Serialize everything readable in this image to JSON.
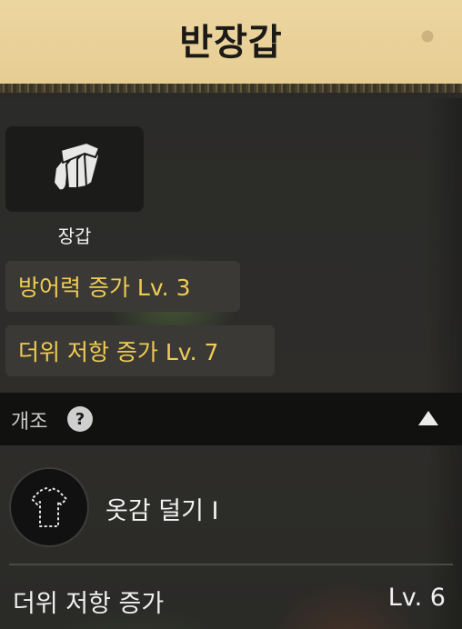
{
  "header": {
    "title": "반장갑"
  },
  "item": {
    "label": "장갑",
    "icon": "glove-icon"
  },
  "stats": [
    {
      "text": "방어력 증가 Lv. 3"
    },
    {
      "text": "더위 저항 증가 Lv. 7"
    }
  ],
  "modification": {
    "section_title": "개조",
    "help_icon": "?",
    "collapse_icon": "▲",
    "option": {
      "label": "옷감 덜기 I",
      "icon": "shirt-outline-icon"
    },
    "effect": {
      "name": "더위 저항 증가",
      "level": "Lv. 6"
    }
  },
  "colors": {
    "banner": "#e9d29a",
    "chip_text": "#f0cb55",
    "panel": "#2a2a28"
  }
}
